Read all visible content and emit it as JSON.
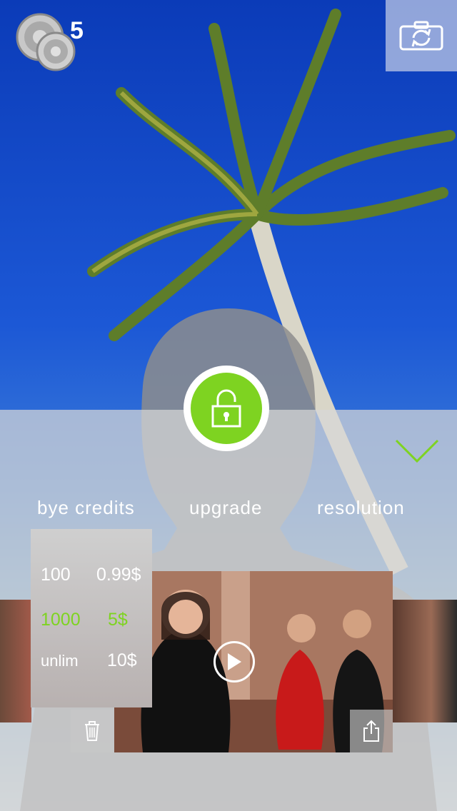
{
  "header": {
    "coin_count": "5",
    "coins_icon": "coins-icon",
    "camera_icon": "camera-switch-icon"
  },
  "main": {
    "lock_icon": "lock-open-icon",
    "collapse_icon": "chevron-down-icon"
  },
  "tabs": [
    {
      "label": "bye credits"
    },
    {
      "label": "upgrade"
    },
    {
      "label": "resolution"
    }
  ],
  "pricing": {
    "rows": [
      {
        "qty": "100",
        "price": "0.99$",
        "highlight": false
      },
      {
        "qty": "1000",
        "price": "5$",
        "highlight": true
      },
      {
        "qty": "unlim",
        "price": "10$",
        "highlight": false
      }
    ]
  },
  "video": {
    "play_icon": "play-icon",
    "trash_icon": "trash-icon",
    "share_icon": "share-icon"
  },
  "colors": {
    "accent": "#7ed321",
    "sky": "#1c58d6"
  }
}
